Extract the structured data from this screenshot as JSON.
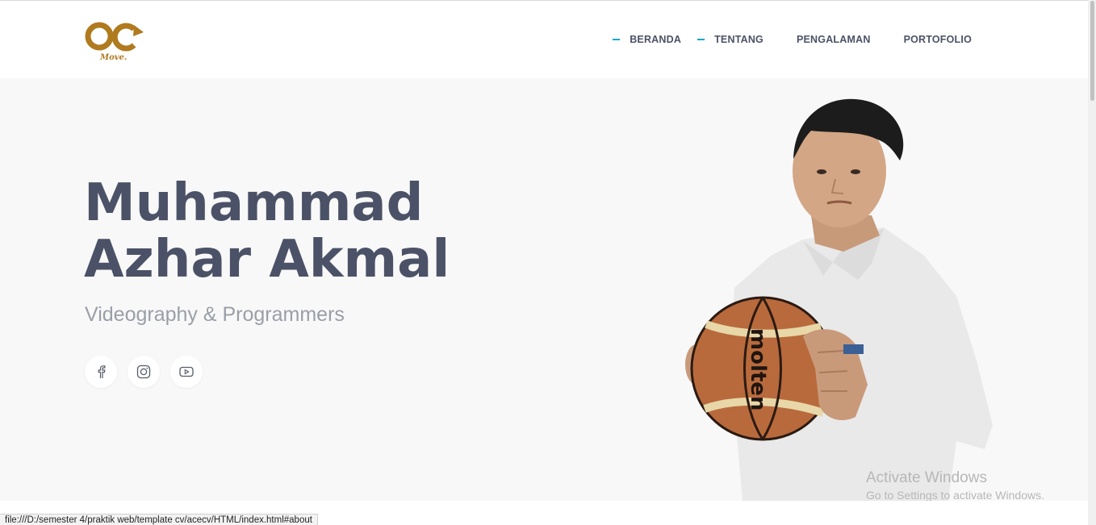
{
  "brand": {
    "logo_text": "Move."
  },
  "nav": {
    "items": [
      {
        "label": "BERANDA",
        "active": true
      },
      {
        "label": "TENTANG",
        "active": true
      },
      {
        "label": "PENGALAMAN",
        "active": false
      },
      {
        "label": "PORTOFOLIO",
        "active": false
      }
    ]
  },
  "hero": {
    "name_line1": "Muhammad",
    "name_line2": "Azhar Akmal",
    "subtitle": "Videography & Programmers",
    "ball_brand": "molten",
    "socials": [
      {
        "icon": "facebook-icon"
      },
      {
        "icon": "instagram-icon"
      },
      {
        "icon": "youtube-icon"
      }
    ]
  },
  "watermark": {
    "line1": "Activate Windows",
    "line2": "Go to Settings to activate Windows."
  },
  "statusbar": {
    "url": "file:///D:/semester 4/praktik web/template cv/acecv/HTML/index.html#about"
  },
  "colors": {
    "accent": "#17a8c9",
    "heading": "#4b5267",
    "logo": "#b07a1f"
  }
}
